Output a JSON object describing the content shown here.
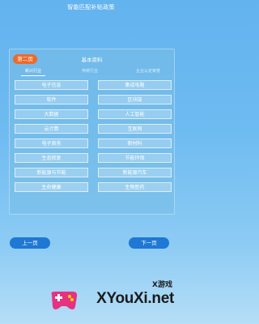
{
  "header": {
    "title": "智能匹配补贴政策"
  },
  "panel": {
    "page_badge": "第二页",
    "title": "基本资料",
    "tabs": [
      {
        "label": "新兴行业"
      },
      {
        "label": "传统行业"
      },
      {
        "label": "企业认定荣誉"
      }
    ],
    "options": [
      "电子信息",
      "集成电路",
      "软件",
      "区块链",
      "大数据",
      "人工智能",
      "云计算",
      "互联网",
      "电子商务",
      "新材料",
      "生态修复",
      "节能环保",
      "新能源与节能",
      "新能源汽车",
      "生命健康",
      "生物医药"
    ]
  },
  "nav": {
    "prev_label": "上一页",
    "next_label": "下一页"
  },
  "watermark": {
    "top_text": "X游戏",
    "main_text": "XYouXi.net"
  },
  "colors": {
    "badge": "#ee6a2b",
    "button": "#1f78d3",
    "background": "#63b3ef"
  }
}
